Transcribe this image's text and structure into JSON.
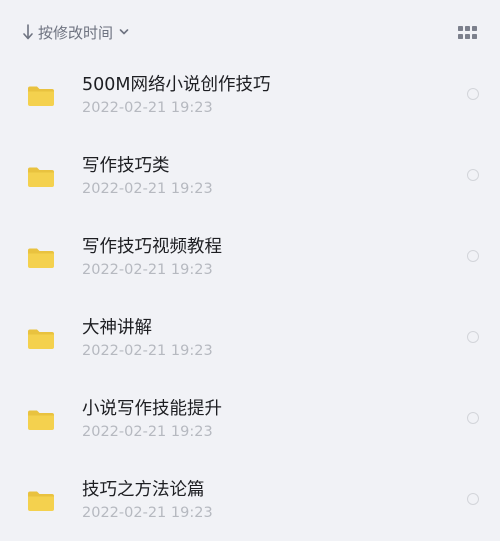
{
  "sort": {
    "label": "按修改时间",
    "arrow_icon": "arrow-down-icon",
    "chevron_icon": "chevron-down-icon"
  },
  "view_toggle_icon": "grid-view-icon",
  "colors": {
    "background": "#F1F2F6",
    "folder": "#F4D14E",
    "folder_tab": "#E9C23F",
    "title_text": "#1D1E22",
    "date_text": "#B6B9C0",
    "header_text": "#6E7380"
  },
  "files": [
    {
      "name": "500M网络小说创作技巧",
      "date": "2022-02-21 19:23",
      "icon": "folder-icon"
    },
    {
      "name": "写作技巧类",
      "date": "2022-02-21 19:23",
      "icon": "folder-icon"
    },
    {
      "name": "写作技巧视频教程",
      "date": "2022-02-21 19:23",
      "icon": "folder-icon"
    },
    {
      "name": "大神讲解",
      "date": "2022-02-21 19:23",
      "icon": "folder-icon"
    },
    {
      "name": "小说写作技能提升",
      "date": "2022-02-21 19:23",
      "icon": "folder-icon"
    },
    {
      "name": "技巧之方法论篇",
      "date": "2022-02-21 19:23",
      "icon": "folder-icon"
    }
  ]
}
